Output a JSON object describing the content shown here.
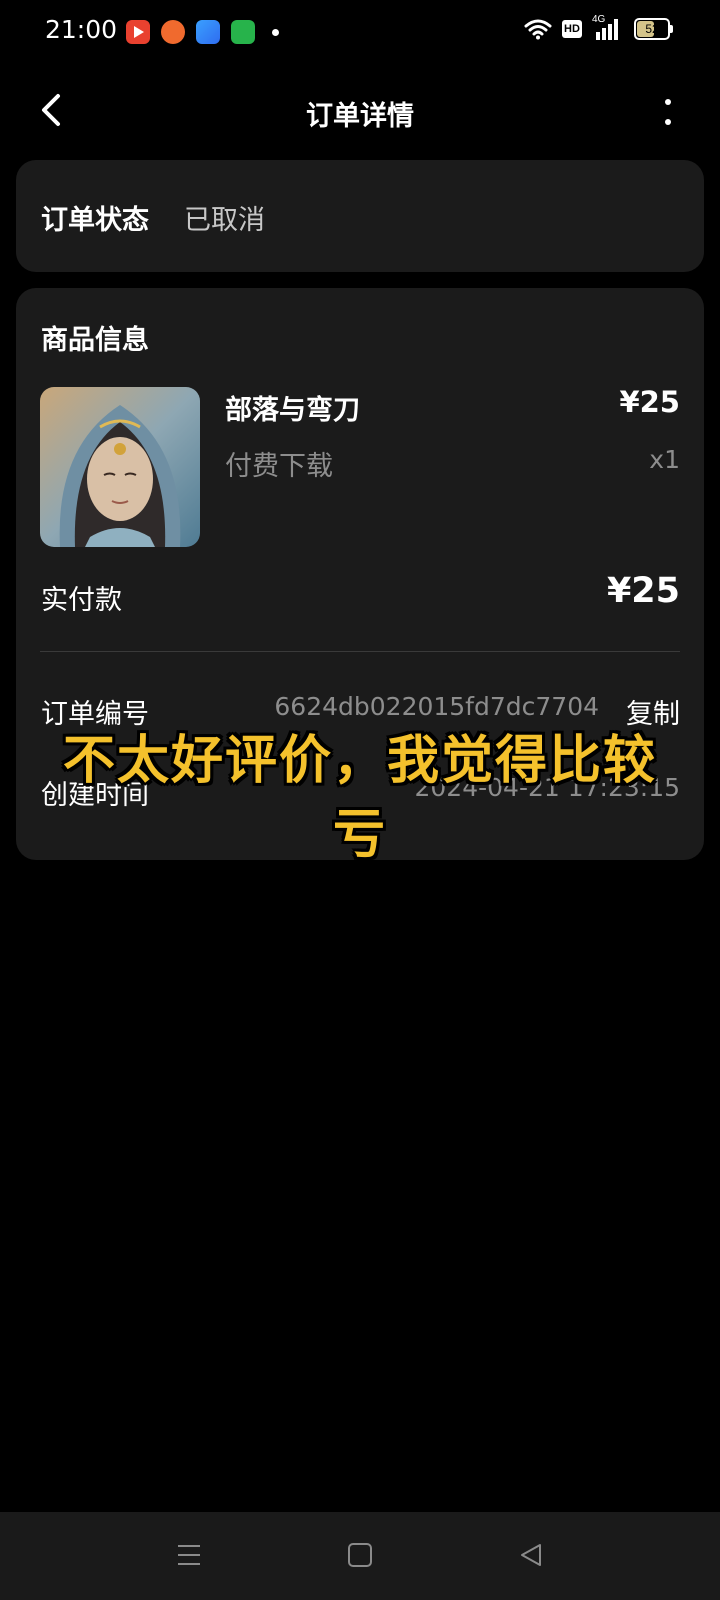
{
  "status_bar": {
    "time": "21:00",
    "network": "4G",
    "hd": "HD",
    "battery": "52"
  },
  "header": {
    "title": "订单详情"
  },
  "order_status": {
    "label": "订单状态",
    "value": "已取消"
  },
  "product_section": {
    "title": "商品信息",
    "name": "部落与弯刀",
    "price": "¥25",
    "type": "付费下载",
    "quantity": "x1"
  },
  "payment": {
    "label": "实付款",
    "amount": "¥25"
  },
  "order_info": {
    "number_label": "订单编号",
    "number_value": "6624db022015fd7dc7704",
    "copy_label": "复制",
    "created_label": "创建时间",
    "created_value": "2024-04-21   17:23:15"
  },
  "caption": {
    "text": "不太好评价，我觉得比较亏"
  }
}
